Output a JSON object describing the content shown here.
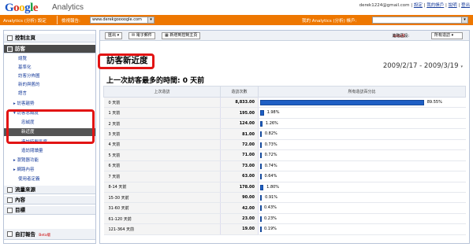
{
  "header": {
    "logo": {
      "g1": "G",
      "o1": "o",
      "o2": "o",
      "g2": "g",
      "l": "l",
      "e": "e"
    },
    "product": "Analytics",
    "user_email": "derek1224@gmail.com",
    "links": [
      "設定",
      "我的帳戶",
      "說明",
      "登出"
    ]
  },
  "navbar": {
    "brand": "Analytics (分析) 設定",
    "view_report_label": "檢視報告:",
    "site_value": "www.derekgoooogle.com",
    "my_account_label": "我的 Analytics (分析) 帳戶:",
    "account_value": ""
  },
  "sidebar": {
    "items": [
      {
        "label": "控制主頁",
        "type": "head",
        "icon": "dashboard-icon"
      },
      {
        "label": "訪客",
        "type": "head-dark",
        "icon": "visitors-icon"
      },
      {
        "label": "總覽",
        "type": "item"
      },
      {
        "label": "基準化",
        "type": "item"
      },
      {
        "label": "訪客分佈圖",
        "type": "item"
      },
      {
        "label": "新的與舊的",
        "type": "item"
      },
      {
        "label": "語言",
        "type": "item"
      },
      {
        "label": "▸ 訪客趨勢",
        "type": "item"
      },
      {
        "label": "▾ 訪客忠誠度",
        "type": "item"
      },
      {
        "label": "忠誠度",
        "type": "item"
      },
      {
        "label": "新近度",
        "type": "item-active"
      },
      {
        "label": "造訪時間長度",
        "type": "item"
      },
      {
        "label": "造訪閱讀量",
        "type": "item"
      },
      {
        "label": "▸ 瀏覽器功能",
        "type": "item"
      },
      {
        "label": "▸ 網路內容",
        "type": "item"
      },
      {
        "label": "使用者定義",
        "type": "item"
      },
      {
        "label": "流量來源",
        "type": "head",
        "icon": "traffic-sources-icon"
      },
      {
        "label": "內容",
        "type": "head",
        "icon": "content-icon"
      },
      {
        "label": "目標",
        "type": "head",
        "icon": "goals-icon"
      }
    ],
    "custom_reports": "自訂報告",
    "custom_reports_badge": "Beta版"
  },
  "toolbar": {
    "export": "匯出",
    "email": "電子郵件",
    "add_to_dashboard": "新增到控制主頁",
    "beta_badge": "Beta版",
    "advanced_segments_label": "進階區段:",
    "segments_value": "所有造訪"
  },
  "page": {
    "title": "訪客新近度",
    "date_range": "2009/2/17 - 2009/3/19",
    "subtitle": "上一次訪客最多的時間:   0 天前"
  },
  "table": {
    "headers": [
      "上次造訪",
      "造訪次數",
      "所有造訪百分比"
    ],
    "rows": [
      {
        "label": "0 天前",
        "count": "8,833.00",
        "pct": "89.55%",
        "value": 89.55
      },
      {
        "label": "1 天前",
        "count": "195.00",
        "pct": "1.98%",
        "value": 1.98
      },
      {
        "label": "2 天前",
        "count": "124.00",
        "pct": "1.26%",
        "value": 1.26
      },
      {
        "label": "3 天前",
        "count": "81.00",
        "pct": "0.82%",
        "value": 0.82
      },
      {
        "label": "4 天前",
        "count": "72.00",
        "pct": "0.73%",
        "value": 0.73
      },
      {
        "label": "5 天前",
        "count": "71.00",
        "pct": "0.72%",
        "value": 0.72
      },
      {
        "label": "6 天前",
        "count": "73.00",
        "pct": "0.74%",
        "value": 0.74
      },
      {
        "label": "7 天前",
        "count": "63.00",
        "pct": "0.64%",
        "value": 0.64
      },
      {
        "label": "8-14 天前",
        "count": "178.00",
        "pct": "1.80%",
        "value": 1.8
      },
      {
        "label": "15-30 天前",
        "count": "90.00",
        "pct": "0.91%",
        "value": 0.91
      },
      {
        "label": "31-60 天前",
        "count": "42.00",
        "pct": "0.43%",
        "value": 0.43
      },
      {
        "label": "61-120 天前",
        "count": "23.00",
        "pct": "0.23%",
        "value": 0.23
      },
      {
        "label": "121-364 天前",
        "count": "19.00",
        "pct": "0.19%",
        "value": 0.19
      }
    ]
  },
  "colors": {
    "accent": "#ee7700",
    "bar": "#1f5fc4",
    "highlight": "#e21414"
  }
}
